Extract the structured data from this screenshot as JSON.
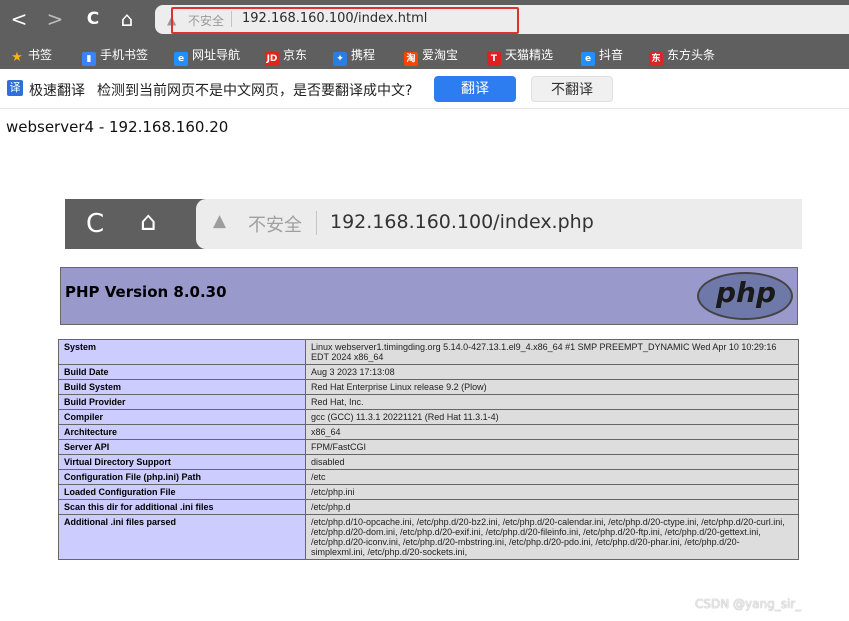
{
  "browser": {
    "nav": {
      "back": "<",
      "forward": ">",
      "reload": "C",
      "home": "⌂"
    },
    "address": {
      "insecure_label": "不安全",
      "url": "192.168.160.100/index.html"
    }
  },
  "bookmarks": [
    {
      "label": "书签",
      "icon": "star-icon",
      "color": "#f7b500"
    },
    {
      "label": "手机书签",
      "icon": "phone-icon",
      "color": "#3b82f6"
    },
    {
      "label": "网址导航",
      "icon": "edge-icon",
      "color": "#1e90ff"
    },
    {
      "label": "京东",
      "icon": "jd-icon",
      "color": "#e1251b"
    },
    {
      "label": "携程",
      "icon": "ctrip-icon",
      "color": "#2a7de1"
    },
    {
      "label": "爱淘宝",
      "icon": "taobao-icon",
      "color": "#ff4400"
    },
    {
      "label": "天猫精选",
      "icon": "tmall-icon",
      "color": "#e02020"
    },
    {
      "label": "抖音",
      "icon": "douyin-icon",
      "color": "#1e90ff"
    },
    {
      "label": "东方头条",
      "icon": "eastday-icon",
      "color": "#d92626"
    }
  ],
  "translate_bar": {
    "name": "极速翻译",
    "message": "检测到当前网页不是中文网页，是否要翻译成中文?",
    "translate_button": "翻译",
    "no_translate_button": "不翻译"
  },
  "page_text": "webserver4 - 192.168.160.20",
  "inner_browser": {
    "insecure_label": "不安全",
    "url": "192.168.160.100/index.php"
  },
  "phpinfo": {
    "version": "PHP Version 8.0.30",
    "logo": "php",
    "rows": [
      {
        "key": "System",
        "value": "Linux webserver1.timingding.org 5.14.0-427.13.1.el9_4.x86_64 #1 SMP PREEMPT_DYNAMIC Wed Apr 10 10:29:16 EDT 2024 x86_64"
      },
      {
        "key": "Build Date",
        "value": "Aug 3 2023 17:13:08"
      },
      {
        "key": "Build System",
        "value": "Red Hat Enterprise Linux release 9.2 (Plow)"
      },
      {
        "key": "Build Provider",
        "value": "Red Hat, Inc."
      },
      {
        "key": "Compiler",
        "value": "gcc (GCC) 11.3.1 20221121 (Red Hat 11.3.1-4)"
      },
      {
        "key": "Architecture",
        "value": "x86_64"
      },
      {
        "key": "Server API",
        "value": "FPM/FastCGI"
      },
      {
        "key": "Virtual Directory Support",
        "value": "disabled"
      },
      {
        "key": "Configuration File (php.ini) Path",
        "value": "/etc"
      },
      {
        "key": "Loaded Configuration File",
        "value": "/etc/php.ini"
      },
      {
        "key": "Scan this dir for additional .ini files",
        "value": "/etc/php.d"
      },
      {
        "key": "Additional .ini files parsed",
        "value": "/etc/php.d/10-opcache.ini, /etc/php.d/20-bz2.ini, /etc/php.d/20-calendar.ini, /etc/php.d/20-ctype.ini, /etc/php.d/20-curl.ini, /etc/php.d/20-dom.ini, /etc/php.d/20-exif.ini, /etc/php.d/20-fileinfo.ini, /etc/php.d/20-ftp.ini, /etc/php.d/20-gettext.ini, /etc/php.d/20-iconv.ini, /etc/php.d/20-mbstring.ini, /etc/php.d/20-pdo.ini, /etc/php.d/20-phar.ini, /etc/php.d/20-simplexml.ini, /etc/php.d/20-sockets.ini,"
      }
    ]
  },
  "watermark": "CSDN @yang_sir_"
}
